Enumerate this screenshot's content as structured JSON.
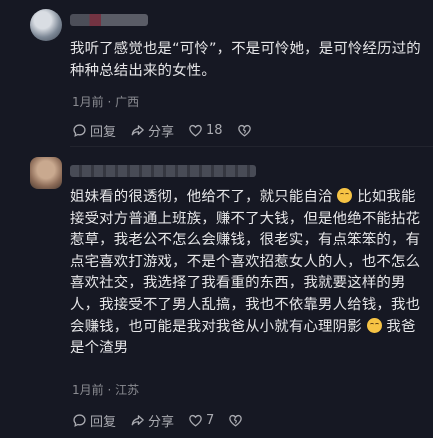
{
  "comments": [
    {
      "text": "我听了感觉也是“可怜”，不是可怜她，是可怜经历过的种种总结出来的女性。",
      "time": "1月前",
      "location": "广西",
      "reply_label": "回复",
      "share_label": "分享",
      "like_count": "18"
    },
    {
      "text_1": "姐妹看的很透彻，他给不了，就只能自洽",
      "text_2": "比如我能接受对方普通上班族，赚不了大钱，但是他绝不能拈花惹草，我老公不怎么会赚钱，很老实，有点笨笨的，有点宅喜欢打游戏，不是个喜欢招惹女人的人，也不怎么喜欢社交，我选择了我看重的东西，我就要这样的男人，我接受不了男人乱搞，我也不依靠男人给钱，我也会赚钱，也可能是我对我爸从小就有心理阴影",
      "text_3": "我爸是个渣男",
      "time": "1月前",
      "location": "江苏",
      "reply_label": "回复",
      "share_label": "分享",
      "like_count": "7"
    }
  ],
  "meta_separator": "·",
  "colors": {
    "background": "#161823",
    "text": "#e6e6e8",
    "muted": "#8a8b91"
  }
}
